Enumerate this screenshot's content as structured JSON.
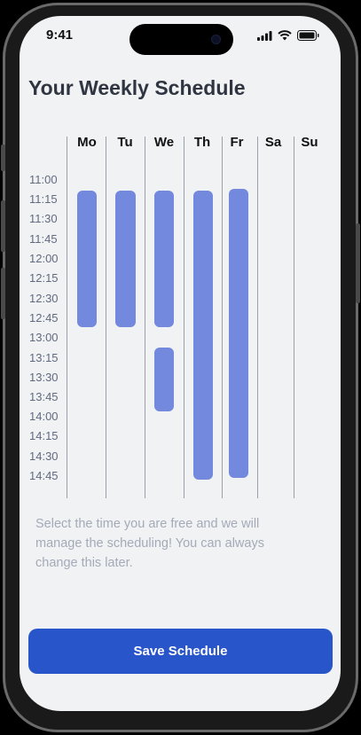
{
  "status_bar": {
    "time": "9:41"
  },
  "header": {
    "title": "Your Weekly Schedule"
  },
  "days": [
    "Mo",
    "Tu",
    "We",
    "Th",
    "Fr",
    "Sa",
    "Su"
  ],
  "time_slots": [
    "11:00",
    "11:15",
    "11:30",
    "11:45",
    "12:00",
    "12:15",
    "12:30",
    "12:45",
    "13:00",
    "13:15",
    "13:30",
    "13:45",
    "14:00",
    "14:15",
    "14:30",
    "14:45"
  ],
  "selected_ranges": [
    {
      "day": "Mo",
      "start": "11:15",
      "end": "13:00"
    },
    {
      "day": "Tu",
      "start": "11:15",
      "end": "13:00"
    },
    {
      "day": "We",
      "start": "11:15",
      "end": "13:00"
    },
    {
      "day": "We",
      "start": "13:15",
      "end": "14:00"
    },
    {
      "day": "Th",
      "start": "11:15",
      "end": "15:00"
    },
    {
      "day": "Fr",
      "start": "11:15",
      "end": "15:00"
    }
  ],
  "hint_text": "Select the time you are free and we will manage the scheduling! You can always change this later.",
  "actions": {
    "save_label": "Save Schedule"
  },
  "colors": {
    "accent": "#2855c9",
    "block": "#7389dd",
    "background": "#f1f2f4"
  }
}
